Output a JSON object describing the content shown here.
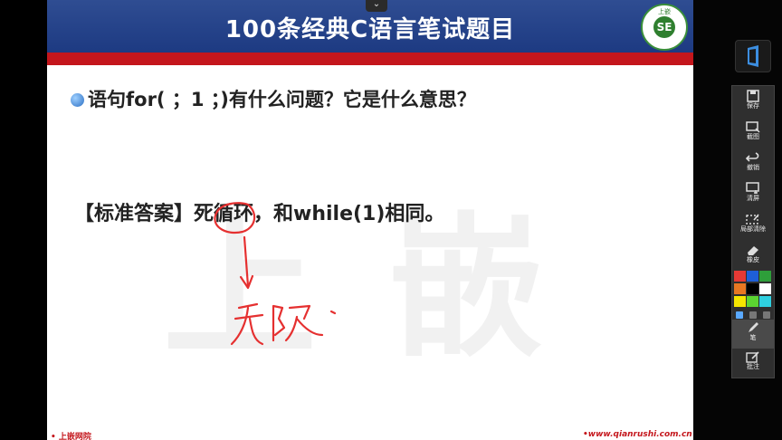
{
  "slide": {
    "title": "100条经典C语言笔试题目",
    "logo_text": "上嵌",
    "logo_letters": "SE",
    "watermark": [
      "上",
      "嵌"
    ],
    "question": "语句for( ；1 ；)有什么问题？它是什么意思？",
    "answer": "【标准答案】死循环，和while(1)相同。",
    "footer_left": "• 上嵌网院",
    "footer_right": "•www.qianrushi.com.cn",
    "accent_colors": {
      "header": "#1d3a82",
      "red_bar": "#c4161c",
      "ink": "#e53030"
    }
  },
  "toolbar": {
    "items": [
      {
        "label": "保存",
        "icon": "save-icon"
      },
      {
        "label": "截图",
        "icon": "screenshot-icon"
      },
      {
        "label": "撤销",
        "icon": "undo-icon"
      },
      {
        "label": "清屏",
        "icon": "clear-screen-icon"
      },
      {
        "label": "局部清除",
        "icon": "partial-clear-icon"
      },
      {
        "label": "橡皮",
        "icon": "eraser-icon"
      },
      {
        "label": "笔",
        "icon": "pen-icon"
      },
      {
        "label": "批注",
        "icon": "annotate-icon"
      }
    ],
    "colors": [
      "#e53935",
      "#1e5fd8",
      "#2e9e3a",
      "#e87722",
      "#000000",
      "#ffffff",
      "#f5e500",
      "#5bd431",
      "#2fd0e0"
    ],
    "selected_tool": "笔"
  }
}
